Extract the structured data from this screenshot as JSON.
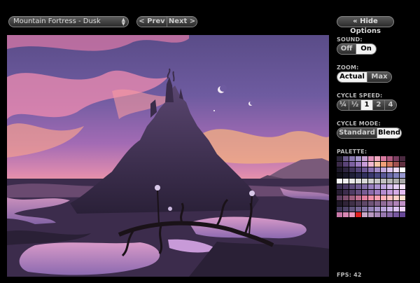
{
  "toolbar": {
    "scene_name": "Mountain Fortress - Dusk",
    "prev_label": "< Prev",
    "next_label": "Next >",
    "hide_options_label": "« Hide Options"
  },
  "options": {
    "sound": {
      "label": "SOUND:",
      "options": [
        "Off",
        "On"
      ],
      "selected": "On"
    },
    "zoom": {
      "label": "ZOOM:",
      "options": [
        "Actual",
        "Max"
      ],
      "selected": "Actual"
    },
    "cycle_speed": {
      "label": "CYCLE SPEED:",
      "options": [
        "¼",
        "½",
        "1",
        "2",
        "4"
      ],
      "selected": "1"
    },
    "cycle_mode": {
      "label": "CYCLE MODE:",
      "options": [
        "Standard",
        "Blend"
      ],
      "selected": "Blend"
    },
    "palette_label": "PALETTE:"
  },
  "status": {
    "fps": "FPS: 42"
  },
  "palette_colors": [
    "#2a2438",
    "#6a5a8a",
    "#8a78b0",
    "#a496c8",
    "#c8a0d0",
    "#e090b8",
    "#f0a8c0",
    "#d87aa0",
    "#b05a80",
    "#7a3e60",
    "#4a2a40",
    "#3a2a48",
    "#5a4478",
    "#7c60a0",
    "#9c7cc0",
    "#c89cd8",
    "#f0b8d0",
    "#f8c8a8",
    "#f0a078",
    "#d07860",
    "#a05050",
    "#603040",
    "#1c1828",
    "#2e2640",
    "#40345a",
    "#544478",
    "#6c5894",
    "#8870b0",
    "#a48cc8",
    "#c0a8dc",
    "#dcc4ec",
    "#f0dcf8",
    "#ffffff",
    "#101018",
    "#181828",
    "#202038",
    "#28284a",
    "#30305c",
    "#3a3a6e",
    "#484880",
    "#585894",
    "#6a6aa8",
    "#8080bc",
    "#9898d0",
    "#f8f8f8",
    "#f0f0f0",
    "#e8e8e8",
    "#e0e0e0",
    "#d8d8d8",
    "#d0d0d0",
    "#c8c8c8",
    "#c0c0c0",
    "#b8b8b8",
    "#b0b0b0",
    "#a8a8a8",
    "#3a2e50",
    "#4c3c66",
    "#5e4c7c",
    "#705c92",
    "#846ea8",
    "#9880be",
    "#ac94d0",
    "#c0a8e0",
    "#d4bcec",
    "#e6d0f6",
    "#f8e4ff",
    "#281e34",
    "#3c2c4c",
    "#503c64",
    "#644c7c",
    "#785c94",
    "#8c6cac",
    "#a07cc0",
    "#b48cd0",
    "#c49cdc",
    "#d4ace6",
    "#e4bcf0",
    "#604060",
    "#805070",
    "#a06080",
    "#c07090",
    "#e080a0",
    "#f090a8",
    "#f8a0b0",
    "#ffb0b8",
    "#ffc0c0",
    "#ffd0c8",
    "#ffe0d0",
    "#201828",
    "#302438",
    "#403048",
    "#503c58",
    "#604868",
    "#705478",
    "#806088",
    "#906c98",
    "#a078a8",
    "#b084b8",
    "#c090c8",
    "#3c3454",
    "#4e4468",
    "#60547c",
    "#726490",
    "#8474a4",
    "#9684b8",
    "#a894ca",
    "#baa4da",
    "#ccb4e8",
    "#dec4f4",
    "#f0d4ff",
    "#c878a8",
    "#d888b4",
    "#e898c0",
    "#e02020",
    "#c8a8c8",
    "#b898c0",
    "#a888b8",
    "#9878b0",
    "#8868a8",
    "#7858a0",
    "#684898"
  ]
}
